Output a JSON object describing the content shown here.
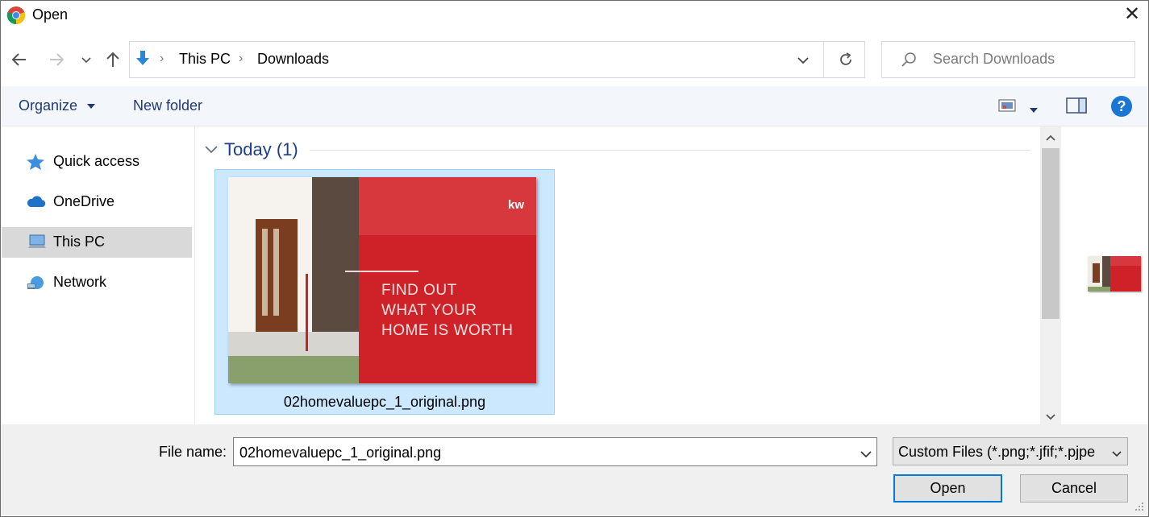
{
  "window": {
    "title": "Open",
    "close_glyph": "✕"
  },
  "nav": {
    "back_icon": "arrow-left-icon",
    "forward_icon": "arrow-right-icon",
    "recent_icon": "chevron-down-icon",
    "up_icon": "arrow-up-icon",
    "breadcrumb": [
      "This PC",
      "Downloads"
    ],
    "refresh_icon": "refresh-icon",
    "search_placeholder": "Search Downloads"
  },
  "commands": {
    "organize": "Organize",
    "new_folder": "New folder",
    "help": "?"
  },
  "sidebar": {
    "items": [
      {
        "label": "Quick access",
        "icon": "star-icon",
        "selected": false
      },
      {
        "label": "OneDrive",
        "icon": "cloud-icon",
        "selected": false
      },
      {
        "label": "This PC",
        "icon": "computer-icon",
        "selected": true
      },
      {
        "label": "Network",
        "icon": "network-icon",
        "selected": false
      }
    ]
  },
  "content": {
    "group_label": "Today (1)",
    "files": [
      {
        "name": "02homevaluepc_1_original.png",
        "thumb_logo": "kw",
        "thumb_lines": [
          "FIND OUT",
          "WHAT YOUR",
          "HOME IS WORTH"
        ]
      }
    ]
  },
  "bottom": {
    "file_name_label": "File name:",
    "file_name_value": "02homevaluepc_1_original.png",
    "filter_value": "Custom Files (*.png;*.jfif;*.pjpe",
    "open_label": "Open",
    "cancel_label": "Cancel"
  },
  "colors": {
    "accent": "#0078d7",
    "selection": "#cce8ff",
    "brand_red": "#cf2128"
  }
}
